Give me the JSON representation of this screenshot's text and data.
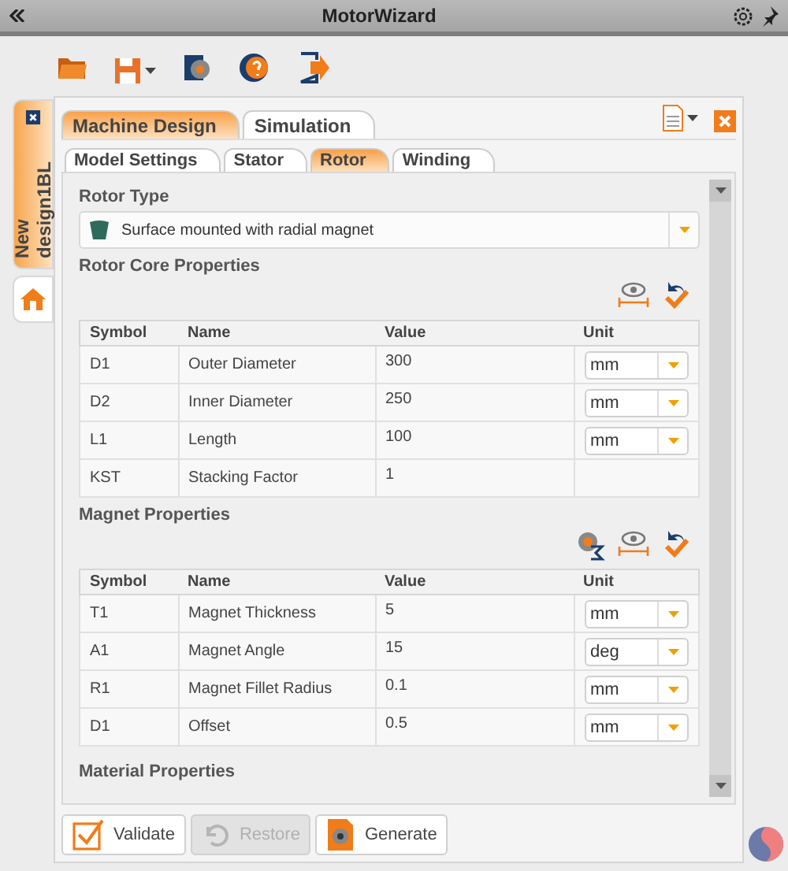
{
  "window": {
    "title": "MotorWizard"
  },
  "side_tabs": [
    {
      "kind": "design",
      "label": "New design1BL",
      "selected": true
    },
    {
      "kind": "home",
      "selected": false
    }
  ],
  "tabs": [
    {
      "label": "Machine Design",
      "selected": true
    },
    {
      "label": "Simulation",
      "selected": false
    }
  ],
  "subtabs": [
    {
      "label": "Model Settings",
      "selected": false
    },
    {
      "label": "Stator",
      "selected": false
    },
    {
      "label": "Rotor",
      "selected": true
    },
    {
      "label": "Winding",
      "selected": false
    }
  ],
  "sections": [
    {
      "kind": "select",
      "title": "Rotor Type",
      "value": "Surface mounted with radial magnet"
    },
    {
      "kind": "table",
      "title": "Rotor Core Properties",
      "columns": [
        "Symbol",
        "Name",
        "Value",
        "Unit"
      ],
      "rows": [
        {
          "symbol": "D1",
          "name": "Outer Diameter",
          "value": "300",
          "unit": "mm"
        },
        {
          "symbol": "D2",
          "name": "Inner Diameter",
          "value": "250",
          "unit": "mm"
        },
        {
          "symbol": "L1",
          "name": "Length",
          "value": "100",
          "unit": "mm"
        },
        {
          "symbol": "KST",
          "name": "Stacking Factor",
          "value": "1"
        }
      ]
    },
    {
      "kind": "table",
      "title": "Magnet Properties",
      "columns": [
        "Symbol",
        "Name",
        "Value",
        "Unit"
      ],
      "rows": [
        {
          "symbol": "T1",
          "name": "Magnet Thickness",
          "value": "5",
          "unit": "mm"
        },
        {
          "symbol": "A1",
          "name": "Magnet Angle",
          "value": "15",
          "unit": "deg"
        },
        {
          "symbol": "R1",
          "name": "Magnet Fillet Radius",
          "value": "0.1",
          "unit": "mm"
        },
        {
          "symbol": "D1",
          "name": "Offset",
          "value": "0.5",
          "unit": "mm"
        }
      ]
    },
    {
      "kind": "heading",
      "title": "Material Properties"
    }
  ],
  "buttons": [
    {
      "kind": "validate",
      "label": "Validate",
      "disabled": false
    },
    {
      "kind": "restore",
      "label": "Restore",
      "disabled": true
    },
    {
      "kind": "generate",
      "label": "Generate",
      "disabled": false
    }
  ]
}
